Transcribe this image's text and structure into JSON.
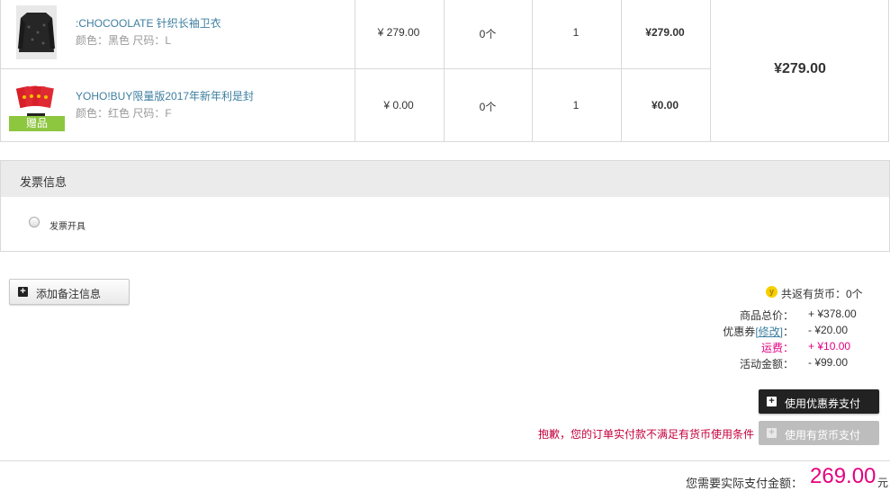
{
  "items": [
    {
      "name": ":CHOCOOLATE 针织长袖卫衣",
      "spec": "颜色：黑色 尺码：L",
      "price": "¥ 279.00",
      "coins": "0个",
      "qty": "1",
      "subtotal": "¥279.00"
    },
    {
      "name": "YOHO!BUY限量版2017年新年利是封",
      "spec": "颜色：红色 尺码：F",
      "price": "¥ 0.00",
      "coins": "0个",
      "qty": "1",
      "subtotal": "¥0.00",
      "tag": "赠品"
    }
  ],
  "package_total": "¥279.00",
  "invoice": {
    "title": "发票信息",
    "option_label": "发票开具"
  },
  "note_button": "添加备注信息",
  "summary": {
    "coins_return": "共返有货币：0个",
    "coin_icon": "y",
    "rows": [
      {
        "label": "商品总价：",
        "value": "+ ¥378.00"
      },
      {
        "label_prefix": "优惠券",
        "label_link": "[修改]",
        "label_suffix": "：",
        "value": "- ¥20.00"
      },
      {
        "label": "运费：",
        "value": "+ ¥10.00"
      },
      {
        "label": "活动金额：",
        "value": "- ¥99.00"
      }
    ],
    "accent_color": "#e4007f"
  },
  "buttons": {
    "coupon_pay": "使用优惠券支付",
    "coin_pay": "使用有货币支付"
  },
  "warning": "抱歉，您的订单实付款不满足有货币使用条件",
  "payment": {
    "label": "您需要实际支付金额：",
    "amount": "269.00",
    "unit": "元"
  }
}
